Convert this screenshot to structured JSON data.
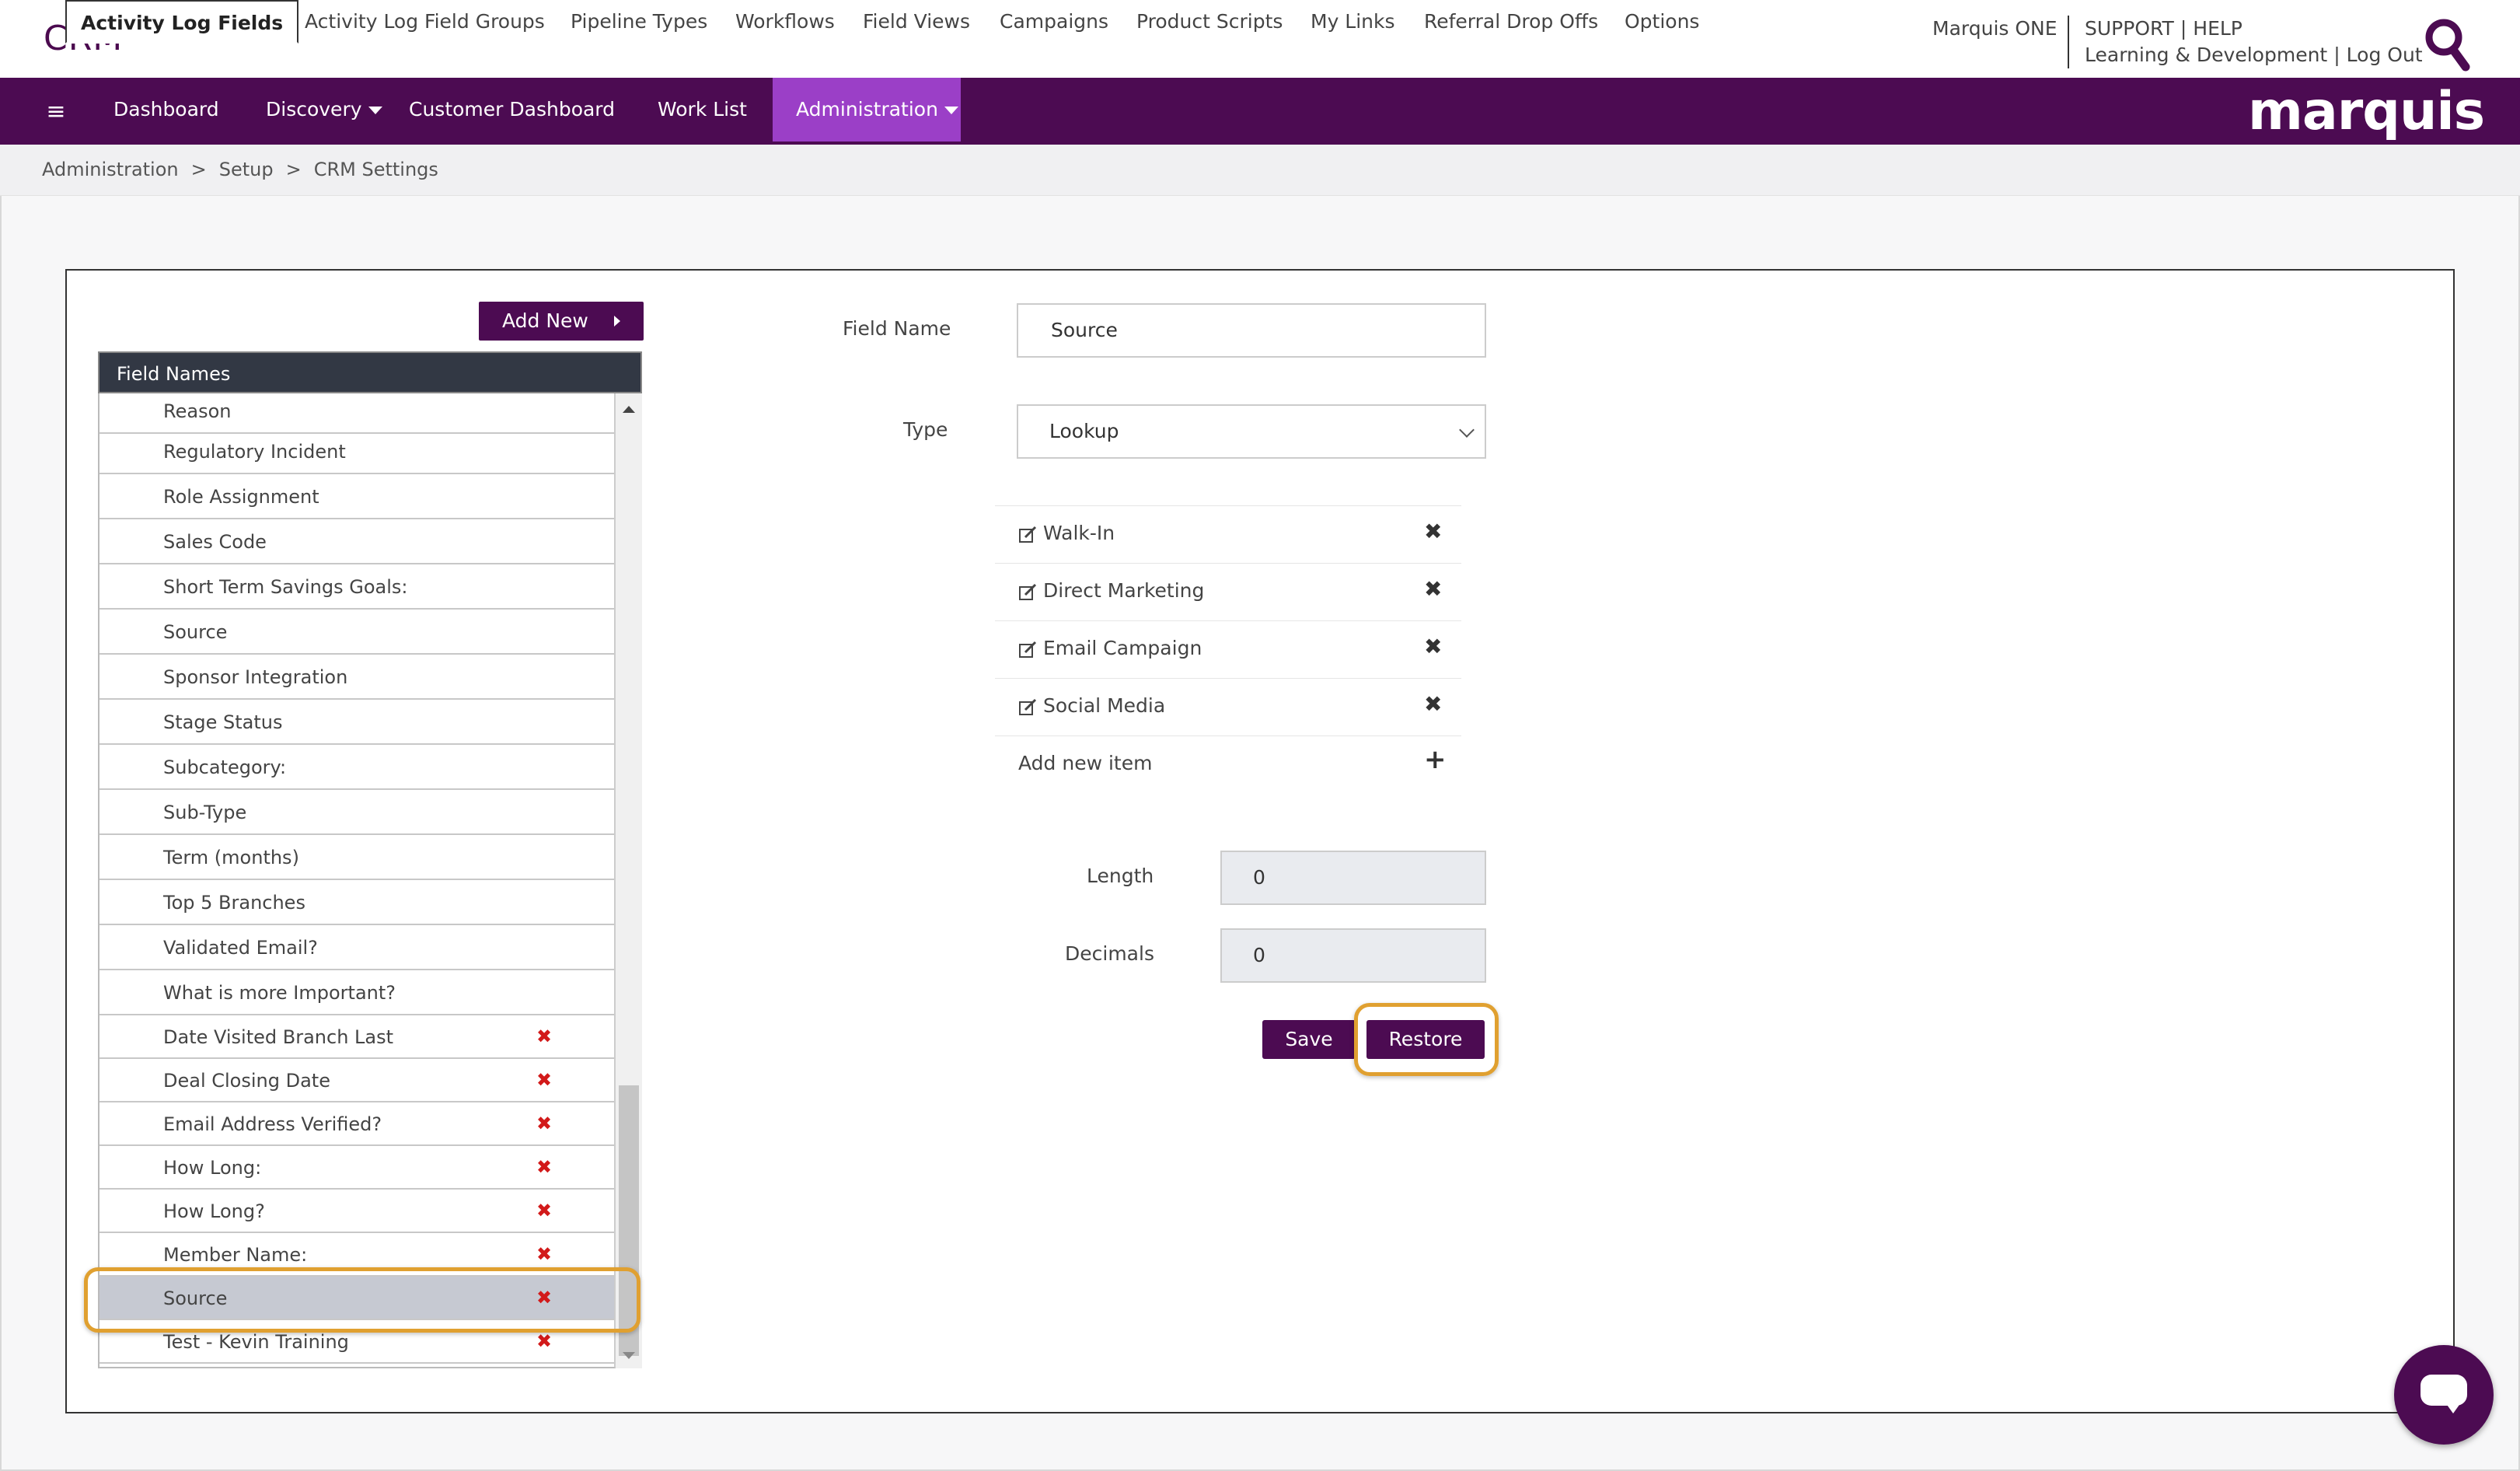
{
  "header": {
    "app_title": "CRM",
    "product": "Marquis ONE",
    "support": "SUPPORT",
    "help": "HELP",
    "learning": "Learning & Development",
    "logout": "Log Out",
    "separator": "|"
  },
  "nav": {
    "items": [
      {
        "label": "Dashboard"
      },
      {
        "label": "Discovery"
      },
      {
        "label": "Customer Dashboard"
      },
      {
        "label": "Work List"
      },
      {
        "label": "Administration"
      }
    ],
    "brand": "marquis",
    "active_color": "#9b3fc7",
    "bar_color": "#4c0b52"
  },
  "breadcrumb": [
    "Administration",
    "Setup",
    "CRM Settings"
  ],
  "breadcrumb_sep": ">",
  "tabs": [
    "Activity Log Fields",
    "Activity Log Field Groups",
    "Pipeline Types",
    "Workflows",
    "Field Views",
    "Campaigns",
    "Product Scripts",
    "My Links",
    "Referral Drop Offs",
    "Options"
  ],
  "left": {
    "add_new": "Add New",
    "list_header": "Field Names",
    "rows": [
      {
        "label": "Reason",
        "deletable": false
      },
      {
        "label": "Regulatory Incident",
        "deletable": false
      },
      {
        "label": "Role Assignment",
        "deletable": false
      },
      {
        "label": "Sales Code",
        "deletable": false
      },
      {
        "label": "Short Term Savings Goals:",
        "deletable": false
      },
      {
        "label": "Source",
        "deletable": false
      },
      {
        "label": "Sponsor Integration",
        "deletable": false
      },
      {
        "label": "Stage Status",
        "deletable": false
      },
      {
        "label": "Subcategory:",
        "deletable": false
      },
      {
        "label": "Sub-Type",
        "deletable": false
      },
      {
        "label": "Term (months)",
        "deletable": false
      },
      {
        "label": "Top 5 Branches",
        "deletable": false
      },
      {
        "label": "Validated Email?",
        "deletable": false
      },
      {
        "label": "What is more Important?",
        "deletable": false
      },
      {
        "label": "Date Visited Branch Last",
        "deletable": true
      },
      {
        "label": "Deal Closing Date",
        "deletable": true
      },
      {
        "label": "Email Address Verified?",
        "deletable": true
      },
      {
        "label": "How Long:",
        "deletable": true
      },
      {
        "label": "How Long?",
        "deletable": true
      },
      {
        "label": "Member Name:",
        "deletable": true
      },
      {
        "label": "Source",
        "deletable": true,
        "selected": true
      },
      {
        "label": "Test - Kevin Training",
        "deletable": true
      }
    ],
    "delete_glyph": "✖"
  },
  "form": {
    "field_name_label": "Field Name",
    "field_name_value": "Source",
    "type_label": "Type",
    "type_value": "Lookup",
    "lookup_items": [
      "Walk-In",
      "Direct Marketing",
      "Email Campaign",
      "Social Media"
    ],
    "add_item_label": "Add new item",
    "remove_glyph": "✖",
    "add_glyph": "+",
    "length_label": "Length",
    "length_value": "0",
    "decimals_label": "Decimals",
    "decimals_value": "0",
    "save": "Save",
    "restore": "Restore"
  },
  "highlight_color": "#e0a030"
}
